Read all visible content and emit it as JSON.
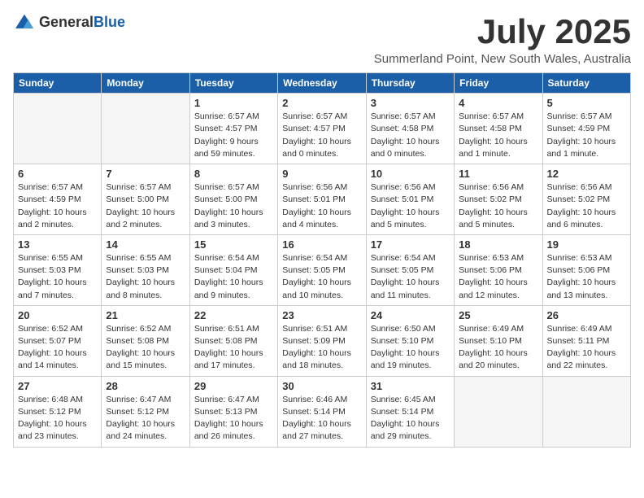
{
  "header": {
    "logo_general": "General",
    "logo_blue": "Blue",
    "month_title": "July 2025",
    "location": "Summerland Point, New South Wales, Australia"
  },
  "weekdays": [
    "Sunday",
    "Monday",
    "Tuesday",
    "Wednesday",
    "Thursday",
    "Friday",
    "Saturday"
  ],
  "weeks": [
    [
      {
        "day": "",
        "info": ""
      },
      {
        "day": "",
        "info": ""
      },
      {
        "day": "1",
        "info": "Sunrise: 6:57 AM\nSunset: 4:57 PM\nDaylight: 9 hours and 59 minutes."
      },
      {
        "day": "2",
        "info": "Sunrise: 6:57 AM\nSunset: 4:57 PM\nDaylight: 10 hours and 0 minutes."
      },
      {
        "day": "3",
        "info": "Sunrise: 6:57 AM\nSunset: 4:58 PM\nDaylight: 10 hours and 0 minutes."
      },
      {
        "day": "4",
        "info": "Sunrise: 6:57 AM\nSunset: 4:58 PM\nDaylight: 10 hours and 1 minute."
      },
      {
        "day": "5",
        "info": "Sunrise: 6:57 AM\nSunset: 4:59 PM\nDaylight: 10 hours and 1 minute."
      }
    ],
    [
      {
        "day": "6",
        "info": "Sunrise: 6:57 AM\nSunset: 4:59 PM\nDaylight: 10 hours and 2 minutes."
      },
      {
        "day": "7",
        "info": "Sunrise: 6:57 AM\nSunset: 5:00 PM\nDaylight: 10 hours and 2 minutes."
      },
      {
        "day": "8",
        "info": "Sunrise: 6:57 AM\nSunset: 5:00 PM\nDaylight: 10 hours and 3 minutes."
      },
      {
        "day": "9",
        "info": "Sunrise: 6:56 AM\nSunset: 5:01 PM\nDaylight: 10 hours and 4 minutes."
      },
      {
        "day": "10",
        "info": "Sunrise: 6:56 AM\nSunset: 5:01 PM\nDaylight: 10 hours and 5 minutes."
      },
      {
        "day": "11",
        "info": "Sunrise: 6:56 AM\nSunset: 5:02 PM\nDaylight: 10 hours and 5 minutes."
      },
      {
        "day": "12",
        "info": "Sunrise: 6:56 AM\nSunset: 5:02 PM\nDaylight: 10 hours and 6 minutes."
      }
    ],
    [
      {
        "day": "13",
        "info": "Sunrise: 6:55 AM\nSunset: 5:03 PM\nDaylight: 10 hours and 7 minutes."
      },
      {
        "day": "14",
        "info": "Sunrise: 6:55 AM\nSunset: 5:03 PM\nDaylight: 10 hours and 8 minutes."
      },
      {
        "day": "15",
        "info": "Sunrise: 6:54 AM\nSunset: 5:04 PM\nDaylight: 10 hours and 9 minutes."
      },
      {
        "day": "16",
        "info": "Sunrise: 6:54 AM\nSunset: 5:05 PM\nDaylight: 10 hours and 10 minutes."
      },
      {
        "day": "17",
        "info": "Sunrise: 6:54 AM\nSunset: 5:05 PM\nDaylight: 10 hours and 11 minutes."
      },
      {
        "day": "18",
        "info": "Sunrise: 6:53 AM\nSunset: 5:06 PM\nDaylight: 10 hours and 12 minutes."
      },
      {
        "day": "19",
        "info": "Sunrise: 6:53 AM\nSunset: 5:06 PM\nDaylight: 10 hours and 13 minutes."
      }
    ],
    [
      {
        "day": "20",
        "info": "Sunrise: 6:52 AM\nSunset: 5:07 PM\nDaylight: 10 hours and 14 minutes."
      },
      {
        "day": "21",
        "info": "Sunrise: 6:52 AM\nSunset: 5:08 PM\nDaylight: 10 hours and 15 minutes."
      },
      {
        "day": "22",
        "info": "Sunrise: 6:51 AM\nSunset: 5:08 PM\nDaylight: 10 hours and 17 minutes."
      },
      {
        "day": "23",
        "info": "Sunrise: 6:51 AM\nSunset: 5:09 PM\nDaylight: 10 hours and 18 minutes."
      },
      {
        "day": "24",
        "info": "Sunrise: 6:50 AM\nSunset: 5:10 PM\nDaylight: 10 hours and 19 minutes."
      },
      {
        "day": "25",
        "info": "Sunrise: 6:49 AM\nSunset: 5:10 PM\nDaylight: 10 hours and 20 minutes."
      },
      {
        "day": "26",
        "info": "Sunrise: 6:49 AM\nSunset: 5:11 PM\nDaylight: 10 hours and 22 minutes."
      }
    ],
    [
      {
        "day": "27",
        "info": "Sunrise: 6:48 AM\nSunset: 5:12 PM\nDaylight: 10 hours and 23 minutes."
      },
      {
        "day": "28",
        "info": "Sunrise: 6:47 AM\nSunset: 5:12 PM\nDaylight: 10 hours and 24 minutes."
      },
      {
        "day": "29",
        "info": "Sunrise: 6:47 AM\nSunset: 5:13 PM\nDaylight: 10 hours and 26 minutes."
      },
      {
        "day": "30",
        "info": "Sunrise: 6:46 AM\nSunset: 5:14 PM\nDaylight: 10 hours and 27 minutes."
      },
      {
        "day": "31",
        "info": "Sunrise: 6:45 AM\nSunset: 5:14 PM\nDaylight: 10 hours and 29 minutes."
      },
      {
        "day": "",
        "info": ""
      },
      {
        "day": "",
        "info": ""
      }
    ]
  ]
}
